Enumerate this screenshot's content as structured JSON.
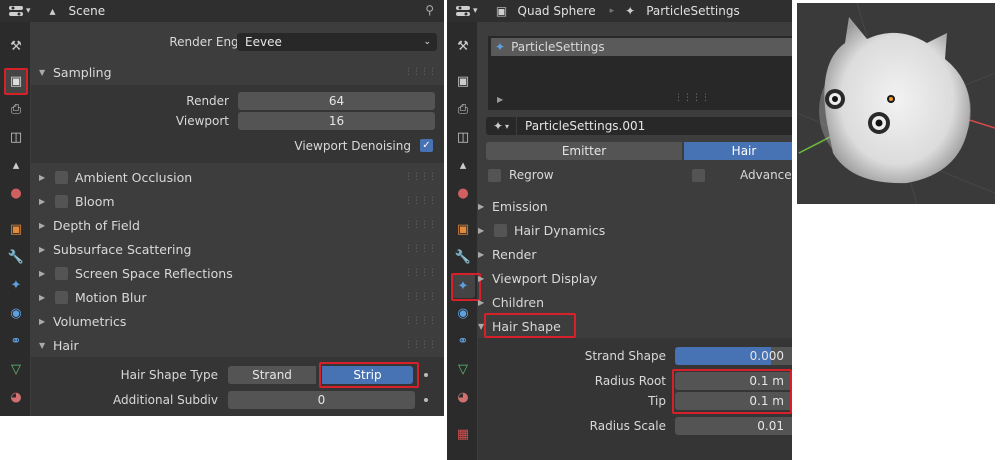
{
  "left_panel": {
    "header": {
      "context": "Scene"
    },
    "render_engine": {
      "label": "Render Engine",
      "value": "Eevee"
    },
    "sampling": {
      "title": "Sampling",
      "render_label": "Render",
      "render_value": "64",
      "viewport_label": "Viewport",
      "viewport_value": "16",
      "denoise_label": "Viewport Denoising"
    },
    "sections": [
      "Ambient Occlusion",
      "Bloom",
      "Depth of Field",
      "Subsurface Scattering",
      "Screen Space Reflections",
      "Motion Blur",
      "Volumetrics"
    ],
    "hair": {
      "title": "Hair",
      "shape_type_label": "Hair Shape Type",
      "option_strand": "Strand",
      "option_strip": "Strip",
      "subdiv_label": "Additional Subdiv",
      "subdiv_value": "0"
    }
  },
  "right_panel": {
    "header": {
      "object": "Quad Sphere",
      "context": "ParticleSettings"
    },
    "list_item": "ParticleSettings",
    "datablock": "ParticleSettings.001",
    "type_emitter": "Emitter",
    "type_hair": "Hair",
    "regrow_label": "Regrow",
    "advanced_label": "Advanced",
    "sections": [
      "Emission",
      "Hair Dynamics",
      "Render",
      "Viewport Display",
      "Children"
    ],
    "hair_shape": {
      "title": "Hair Shape",
      "strand_shape_label": "Strand Shape",
      "strand_shape_value": "0.000",
      "radius_root_label": "Radius Root",
      "radius_root_value": "0.1 m",
      "tip_label": "Tip",
      "tip_value": "0.1 m",
      "radius_scale_label": "Radius Scale",
      "radius_scale_value": "0.01"
    }
  },
  "colors": {
    "highlight": "#d6212b",
    "accent": "#4772b3",
    "panel": "#3d3d3d"
  }
}
